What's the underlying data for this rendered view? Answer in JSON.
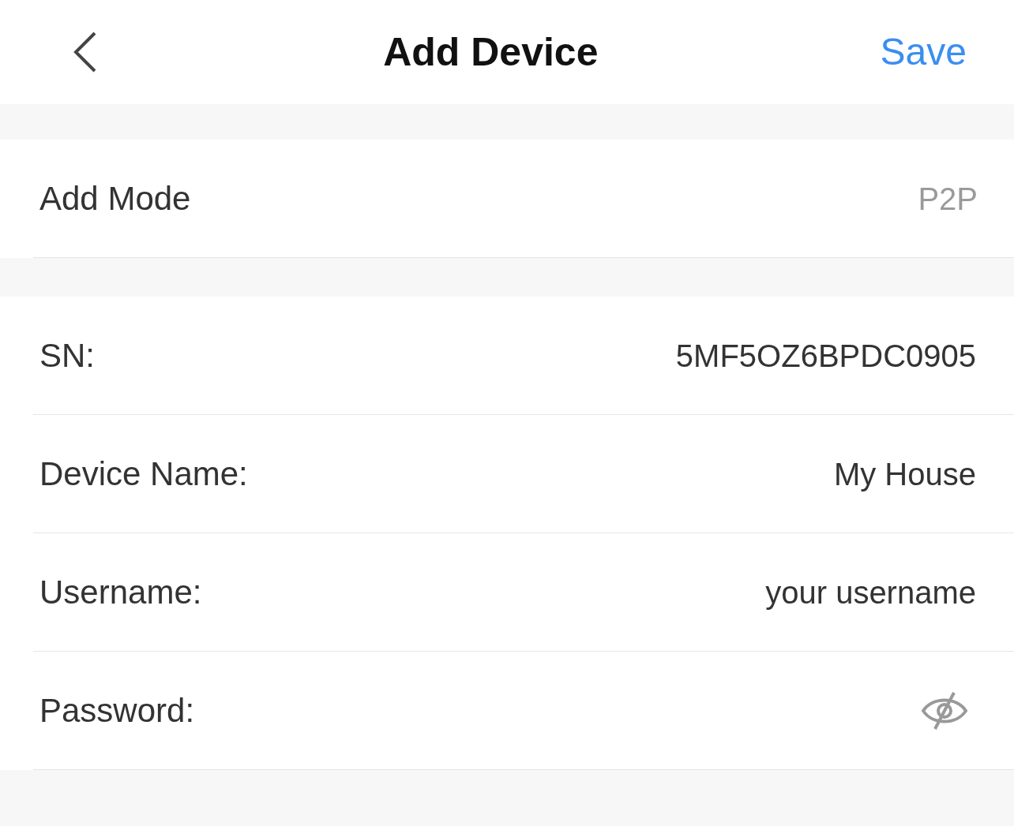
{
  "header": {
    "title": "Add Device",
    "action": "Save"
  },
  "sections": [
    {
      "rows": [
        {
          "kind": "static",
          "label": "Add Mode",
          "value": "P2P"
        }
      ]
    },
    {
      "rows": [
        {
          "kind": "text",
          "label": "SN:",
          "value": "5MF5OZ6BPDC0905"
        },
        {
          "kind": "text",
          "label": "Device Name:",
          "value": "My House"
        },
        {
          "kind": "text",
          "label": "Username:",
          "value": "your username"
        },
        {
          "kind": "password",
          "label": "Password:",
          "hidden": true
        }
      ]
    }
  ]
}
